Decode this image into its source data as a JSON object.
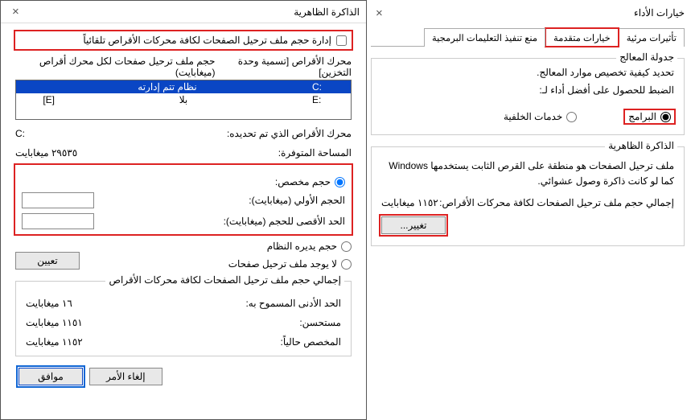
{
  "perf": {
    "title": "خيارات الأداء",
    "close": "×",
    "tabs": {
      "visual": "تأثيرات مرئية",
      "advanced": "خيارات متقدمة",
      "dep": "منع تنفيذ التعليمات البرمجية"
    },
    "sched": {
      "legend": "جدولة المعالج",
      "desc": "تحديد كيفية تخصيص موارد المعالج.",
      "adjust_label": "الضبط للحصول على أفضل أداء لـ:",
      "programs": "البرامج",
      "services": "خدمات الخلفية"
    },
    "vm": {
      "legend": "الذاكرة الظاهرية",
      "desc": "ملف ترحيل الصفحات هو منطقة على القرص الثابت يستخدمها Windows كما لو كانت ذاكرة وصول عشوائي.",
      "total_label": "إجمالي حجم ملف ترحيل الصفحات لكافة محركات الأقراص:",
      "total_value": "١١٥٢ ميغابايت",
      "change_btn": "تغيير..."
    }
  },
  "vmem": {
    "title": "الذاكرة الظاهرية",
    "close": "×",
    "auto_label": "إدارة حجم ملف ترحيل الصفحات لكافة محركات الأقراص تلقائياً",
    "col_drive": "محرك الأقراص [تسمية وحدة التخزين]",
    "col_size": "حجم ملف ترحيل صفحات لكل محرك أقراص (ميغابايت)",
    "drives": [
      {
        "letter": "C:",
        "val": "نظام تتم إدارته"
      },
      {
        "letter": "E:",
        "label": "[E]",
        "val": "بلا"
      }
    ],
    "selected_label": "محرك الأقراص الذي تم تحديده:",
    "selected_value": "C:",
    "space_label": "المساحة المتوفرة:",
    "space_value": "٢٩٥٣٥ ميغابايت",
    "custom_label": "حجم مخصص:",
    "init_label": "الحجم الأولي (ميغابايت):",
    "max_label": "الحد الأقصى للحجم (ميغابايت):",
    "sys_managed": "حجم يديره النظام",
    "no_paging": "لا يوجد ملف ترحيل صفحات",
    "set_btn": "تعيين",
    "totals": {
      "legend": "إجمالي حجم ملف ترحيل الصفحات لكافة محركات الأقراص",
      "min_label": "الحد الأدنى المسموح به:",
      "min_val": "١٦ ميغابايت",
      "rec_label": "مستحسن:",
      "rec_val": "١١٥١ ميغابايت",
      "cur_label": "المخصص حالياً:",
      "cur_val": "١١٥٢ ميغابايت"
    },
    "ok": "موافق",
    "cancel": "إلغاء الأمر"
  }
}
